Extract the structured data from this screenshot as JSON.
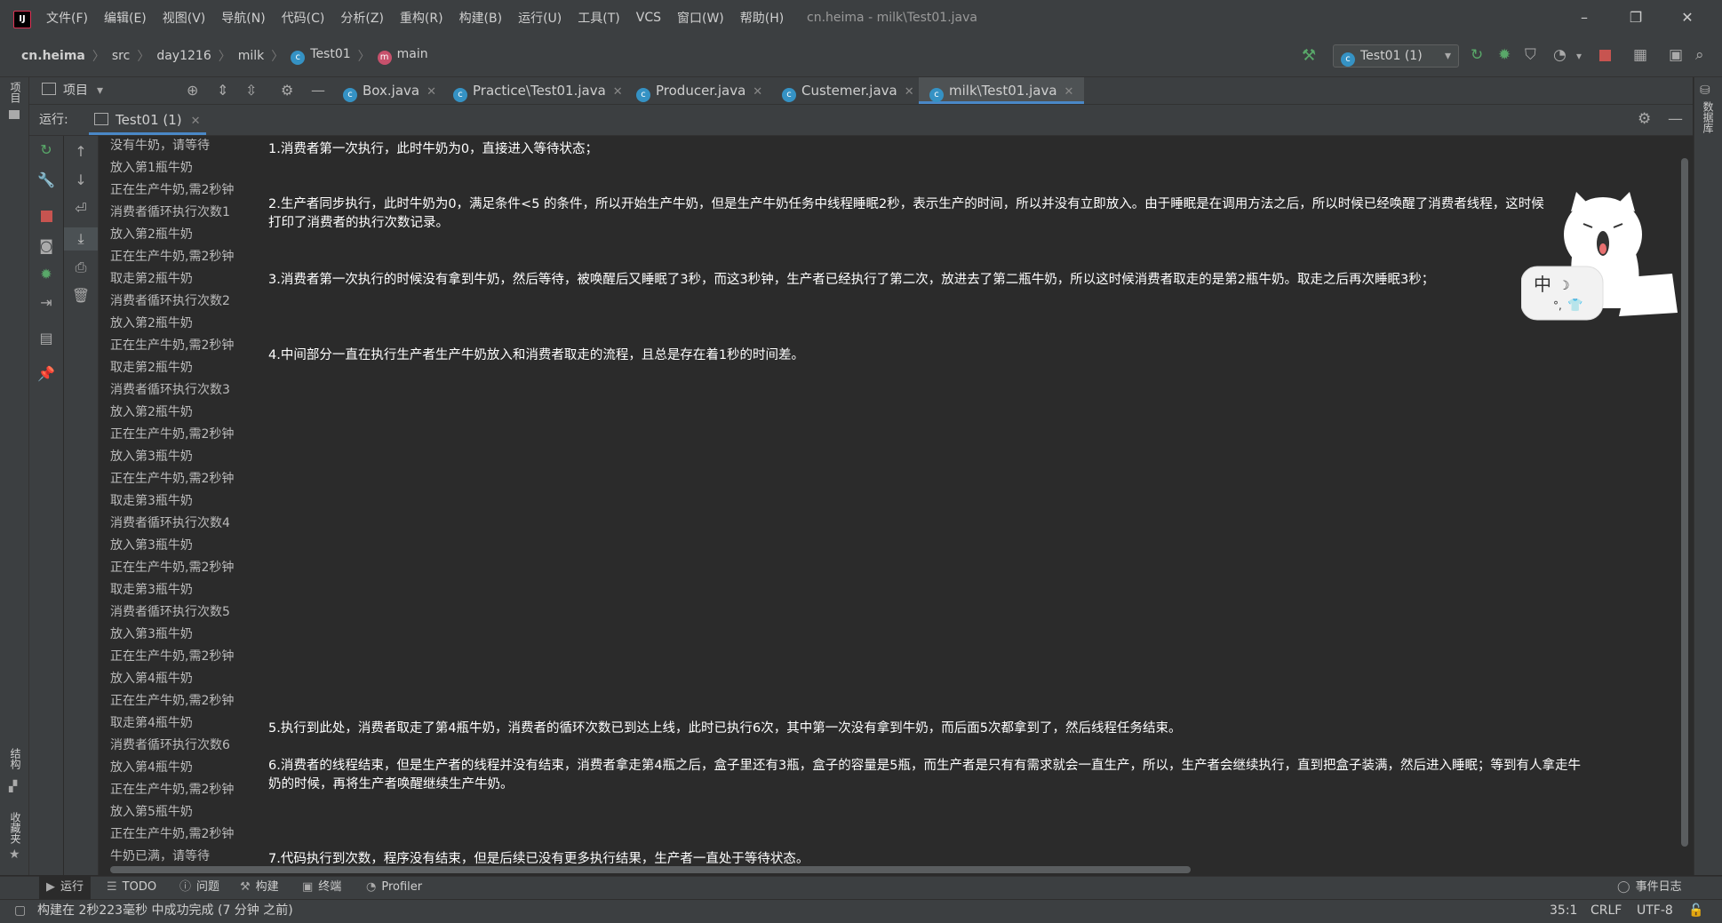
{
  "window": {
    "logo": "IJ",
    "title": "cn.heima - milk\\Test01.java",
    "minimize": "–",
    "restore": "❐",
    "close": "✕"
  },
  "menu": [
    "文件(F)",
    "编辑(E)",
    "视图(V)",
    "导航(N)",
    "代码(C)",
    "分析(Z)",
    "重构(R)",
    "构建(B)",
    "运行(U)",
    "工具(T)",
    "VCS",
    "窗口(W)",
    "帮助(H)"
  ],
  "breadcrumb": {
    "items": [
      "cn.heima",
      "src",
      "day1216",
      "milk",
      "Test01",
      "main"
    ]
  },
  "toolbar": {
    "run_config": "Test01 (1)",
    "icons": [
      "hammer-icon",
      "rerun-icon",
      "debug-icon",
      "coverage-icon",
      "profile-icon",
      "stop-icon",
      "project-structure-icon",
      "terminal-icon"
    ]
  },
  "left_strip": {
    "project_label": "项目",
    "structure_label": "结构",
    "favorites_label": "收藏夹"
  },
  "right_strip": {
    "database_label": "数据库"
  },
  "project_tab": {
    "label": "项目"
  },
  "file_tabs": [
    {
      "label": "Box.java",
      "active": false
    },
    {
      "label": "Practice\\Test01.java",
      "active": false
    },
    {
      "label": "Producer.java",
      "active": false
    },
    {
      "label": "Custemer.java",
      "active": false
    },
    {
      "label": "milk\\Test01.java",
      "active": true
    }
  ],
  "run_panel": {
    "label": "运行:",
    "tab": "Test01 (1)"
  },
  "console": {
    "lines": [
      "没有牛奶，请等待",
      "放入第1瓶牛奶",
      "正在生产牛奶,需2秒钟",
      "消费者循环执行次数1",
      "放入第2瓶牛奶",
      "正在生产牛奶,需2秒钟",
      "取走第2瓶牛奶",
      "消费者循环执行次数2",
      "放入第2瓶牛奶",
      "正在生产牛奶,需2秒钟",
      "取走第2瓶牛奶",
      "消费者循环执行次数3",
      "放入第2瓶牛奶",
      "正在生产牛奶,需2秒钟",
      "放入第3瓶牛奶",
      "正在生产牛奶,需2秒钟",
      "取走第3瓶牛奶",
      "消费者循环执行次数4",
      "放入第3瓶牛奶",
      "正在生产牛奶,需2秒钟",
      "取走第3瓶牛奶",
      "消费者循环执行次数5",
      "放入第3瓶牛奶",
      "正在生产牛奶,需2秒钟",
      "放入第4瓶牛奶",
      "正在生产牛奶,需2秒钟",
      "取走第4瓶牛奶",
      "消费者循环执行次数6",
      "放入第4瓶牛奶",
      "正在生产牛奶,需2秒钟",
      "放入第5瓶牛奶",
      "正在生产牛奶,需2秒钟",
      "牛奶已满，请等待"
    ]
  },
  "notes": [
    "1.消费者第一次执行，此时牛奶为0，直接进入等待状态；",
    "2.生产者同步执行，此时牛奶为0，满足条件<5 的条件，所以开始生产牛奶，但是生产牛奶任务中线程睡眠2秒，表示生产的时间，所以并没有立即放入。由于睡眠是在调用方法之后，所以时候已经唤醒了消费者线程，这时候打印了消费者的执行次数记录。",
    "3.消费者第一次执行的时候没有拿到牛奶，然后等待，被唤醒后又睡眠了3秒，而这3秒钟，生产者已经执行了第二次，放进去了第二瓶牛奶，所以这时候消费者取走的是第2瓶牛奶。取走之后再次睡眠3秒；",
    "4.中间部分一直在执行生产者生产牛奶放入和消费者取走的流程，且总是存在着1秒的时间差。",
    "5.执行到此处，消费者取走了第4瓶牛奶，消费者的循环次数已到达上线，此时已执行6次，其中第一次没有拿到牛奶，而后面5次都拿到了，然后线程任务结束。",
    "6.消费者的线程结束，但是生产者的线程并没有结束，消费者拿走第4瓶之后，盒子里还有3瓶，盒子的容量是5瓶，而生产者是只有有需求就会一直生产，所以，生产者会继续执行，直到把盒子装满，然后进入睡眠；等到有人拿走牛奶的时候，再将生产者唤醒继续生产牛奶。",
    "7.代码执行到次数，程序没有结束，但是后续已没有更多执行结果，生产者一直处于等待状态。"
  ],
  "sticker": {
    "text": "中"
  },
  "bottom_tabs": [
    {
      "label": "运行",
      "icon": "play-icon",
      "active": true
    },
    {
      "label": "TODO",
      "icon": "list-icon",
      "active": false
    },
    {
      "label": "问题",
      "icon": "info-icon",
      "active": false
    },
    {
      "label": "构建",
      "icon": "hammer-icon",
      "active": false
    },
    {
      "label": "终端",
      "icon": "terminal-icon",
      "active": false
    },
    {
      "label": "Profiler",
      "icon": "profiler-icon",
      "active": false
    }
  ],
  "event_log": "事件日志",
  "status": {
    "message": "构建在 2秒223毫秒 中成功完成 (7 分钟 之前)",
    "position": "35:1",
    "line_sep": "CRLF",
    "encoding": "UTF-8"
  }
}
